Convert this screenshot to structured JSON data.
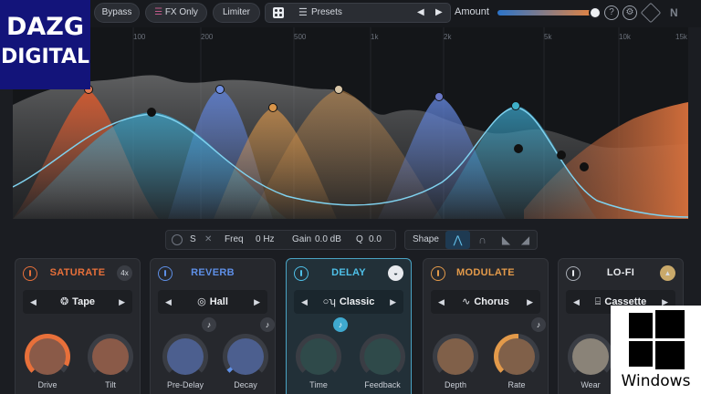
{
  "toolbar": {
    "bypass": "Bypass",
    "fx_only": "FX Only",
    "limiter": "Limiter",
    "presets_label": "Presets",
    "amount_label": "Amount",
    "amount_fraction": 1.0,
    "help_icon": "help-icon",
    "settings_icon": "gear-icon"
  },
  "eq": {
    "freq_ticks": [
      "100",
      "200",
      "500",
      "1k",
      "2k",
      "5k",
      "10k",
      "15k"
    ],
    "band_colors": [
      "#d85a2e",
      "#3aa3c8",
      "#5e7fd1",
      "#d9954a",
      "#6a78c8",
      "#3fb0c9",
      "#d9713c"
    ]
  },
  "param_bar": {
    "s_label": "S",
    "freq_label": "Freq",
    "freq_value": "0 Hz",
    "gain_label": "Gain",
    "gain_value": "0.0 dB",
    "q_label": "Q",
    "q_value": "0.0"
  },
  "shape_bar": {
    "label": "Shape"
  },
  "modules": [
    {
      "title": "SATURATE",
      "title_color": "#e8703a",
      "corner": "4x",
      "selection": "Tape",
      "selection_icon": "tape-icon",
      "knobs": [
        "Drive",
        "Tilt"
      ]
    },
    {
      "title": "REVERB",
      "title_color": "#5e8fe6",
      "selection": "Hall",
      "selection_icon": "hall-icon",
      "knobs": [
        "Pre-Delay",
        "Decay"
      ]
    },
    {
      "title": "DELAY",
      "title_color": "#4fc0e8",
      "selection": "Classic",
      "selection_icon": "delay-icon",
      "knobs": [
        "Time",
        "Feedback"
      ]
    },
    {
      "title": "MODULATE",
      "title_color": "#e39a4a",
      "selection": "Chorus",
      "selection_icon": "chorus-icon",
      "knobs": [
        "Depth",
        "Rate"
      ]
    },
    {
      "title": "LO-FI",
      "title_color": "#e8eaee",
      "selection": "Cassette",
      "selection_icon": "cassette-icon",
      "knobs": [
        "Wear"
      ]
    }
  ],
  "overlay": {
    "logo_line1": "DAZG",
    "logo_line2": "DIGITAL",
    "windows_label": "Windows"
  }
}
